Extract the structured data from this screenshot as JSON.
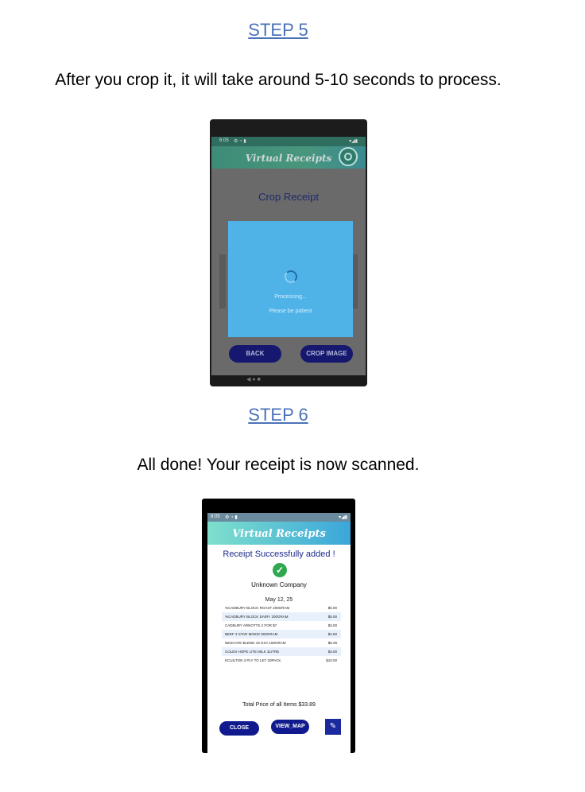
{
  "step5": {
    "heading": "STEP 5",
    "text": "After you crop it, it will take around 5-10 seconds to process.",
    "phone": {
      "status_time": "6:05",
      "status_icons": "⚙ ◔ ▮",
      "signal": "▾◢▮",
      "app_title": "Virtual Receipts",
      "page_title": "Crop Receipt",
      "dialog_processing": "Processing...",
      "dialog_patient": "Please be patient",
      "back_button": "BACK",
      "crop_button": "CROP IMAGE",
      "nav": "◀      ●      ■"
    }
  },
  "step6": {
    "heading": "STEP 6",
    "text": "All done! Your receipt is now scanned.",
    "phone": {
      "status_time": "6:05",
      "status_icons": "⚙ ◔ ▮",
      "signal": "▾◢▮",
      "app_title": "Virtual Receipts",
      "success_message": "Receipt Successfully added !",
      "check": "✓",
      "company": "Unknown Company",
      "date": "May 12, 25",
      "items": [
        {
          "name": "%CADBURY BLOCK ROAST 200GRAM",
          "price": "$5.00"
        },
        {
          "name": "%CADBURY BLOCK DAIRY 200GRAM",
          "price": "$5.00"
        },
        {
          "name": "CADBURY ARNOTTS 2 FOR $7",
          "price": "$3.00"
        },
        {
          "name": "BEEF 3 STAR MINCE 500GRAM",
          "price": "$4.50"
        },
        {
          "name": "NESCAFE BLEND 43 GXA 150GRAM",
          "price": "$9.39"
        },
        {
          "name": "COLES HOPE LITE MILK 3LITRE",
          "price": "$3.00"
        },
        {
          "name": "KCUILTON 3 PLY TO LET 20PACK",
          "price": "$10.00"
        }
      ],
      "total": "Total Price of all Items $33.89",
      "close_button": "CLOSE",
      "map_button": "VIEW_MAP",
      "fab_icon": "✎"
    }
  }
}
